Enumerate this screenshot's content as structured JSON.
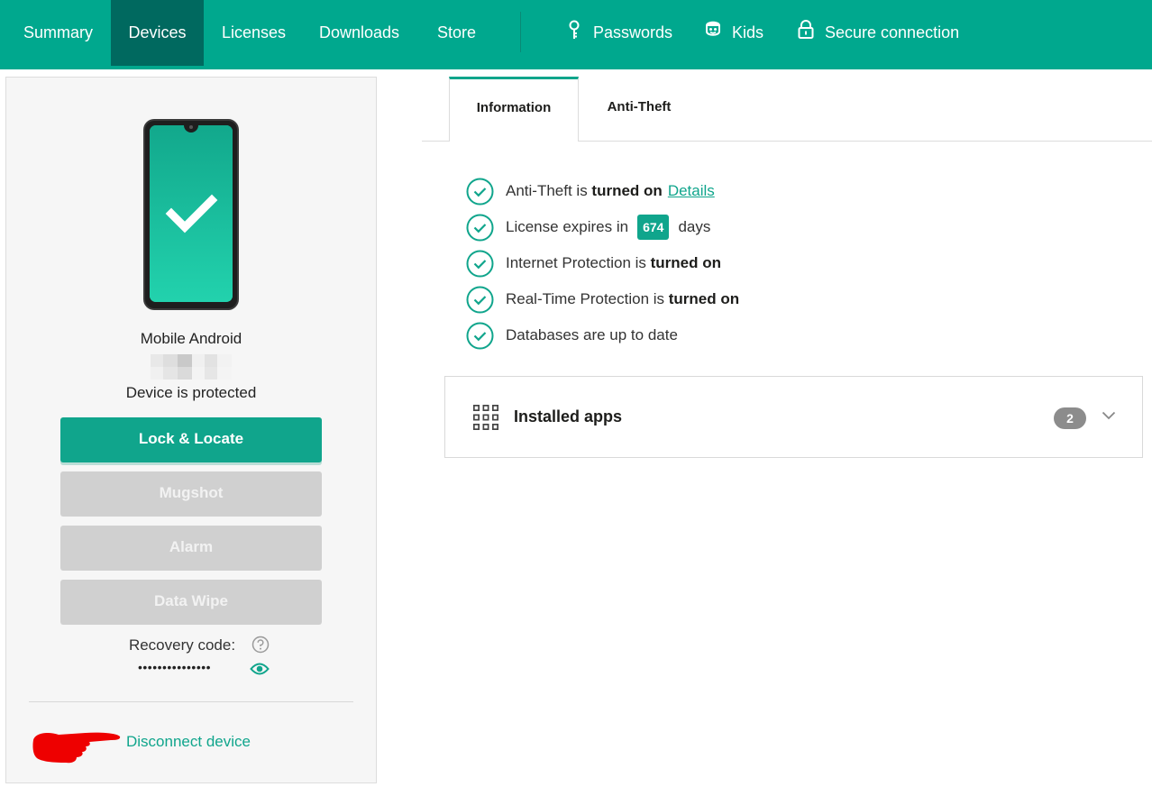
{
  "nav": {
    "items": [
      {
        "label": "Summary"
      },
      {
        "label": "Devices",
        "active": true
      },
      {
        "label": "Licenses"
      },
      {
        "label": "Downloads"
      },
      {
        "label": "Store"
      }
    ],
    "tools": [
      {
        "label": "Passwords",
        "icon": "key-icon"
      },
      {
        "label": "Kids",
        "icon": "kids-icon"
      },
      {
        "label": "Secure connection",
        "icon": "lock-icon"
      }
    ],
    "colors": {
      "bar": "#00a88e",
      "active": "#00695f"
    }
  },
  "device": {
    "name": "Mobile Android",
    "status": "Device is protected",
    "icon": "phone-protected-icon",
    "buttons": {
      "lock_locate": "Lock & Locate",
      "mugshot": "Mugshot",
      "alarm": "Alarm",
      "data_wipe": "Data Wipe"
    },
    "recovery_label": "Recovery code:",
    "recovery_code": "•••••••••••••••",
    "disconnect": "Disconnect device"
  },
  "tabs": [
    {
      "label": "Information",
      "active": true
    },
    {
      "label": "Anti-Theft"
    }
  ],
  "status": {
    "antitheft": {
      "prefix": "Anti-Theft is ",
      "bold": "turned on",
      "link": "Details"
    },
    "license": {
      "prefix": "License expires in",
      "days": "674",
      "suffix": "days"
    },
    "internet": {
      "prefix": "Internet Protection is ",
      "bold": "turned on"
    },
    "realtime": {
      "prefix": "Real-Time Protection is ",
      "bold": "turned on"
    },
    "databases": {
      "text": "Databases are up to date"
    }
  },
  "apps": {
    "title": "Installed apps",
    "count": "2"
  },
  "accent": "#10a58c"
}
